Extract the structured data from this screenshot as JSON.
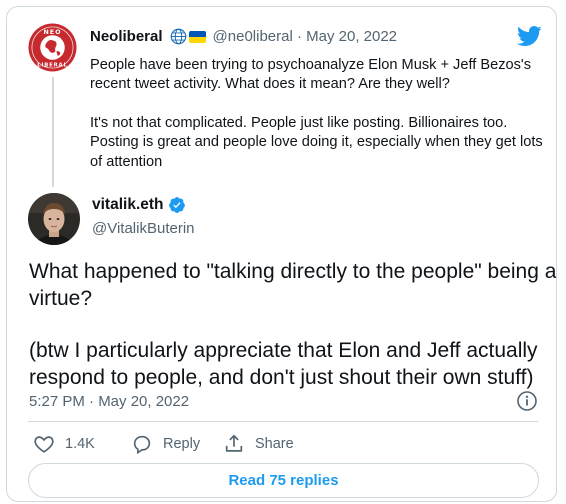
{
  "parent_tweet": {
    "display_name": "Neoliberal",
    "handle_and_date": "@ne0liberal · May 20, 2022",
    "paragraph_1": "People have been trying to psychoanalyze Elon Musk + Jeff Bezos's recent tweet activity. What does it mean? Are they well?",
    "paragraph_2": "It's not that complicated. People just like posting. Billionaires too. Posting is great and people love doing it, especially when they get lots of attention",
    "avatar_icon": "neoliberal-seal-logo",
    "badges": [
      "globe-icon",
      "ukraine-flag-icon"
    ]
  },
  "tweet": {
    "display_name": "vitalik.eth",
    "handle": "@VitalikButerin",
    "verified": true,
    "paragraph_1": "What happened to \"talking directly to the people\" being a virtue?",
    "paragraph_2": "(btw I particularly appreciate that Elon and Jeff actually respond to people, and don't just shout their own stuff)",
    "timestamp": "5:27 PM · May 20, 2022"
  },
  "actions": {
    "likes": "1.4K",
    "reply_label": "Reply",
    "share_label": "Share"
  },
  "read_replies_label": "Read 75 replies",
  "colors": {
    "accent": "#1d9bf0",
    "text": "#0f1419",
    "muted": "#536471",
    "border": "#cfd9de",
    "neoliberal_red": "#c62a2f"
  }
}
